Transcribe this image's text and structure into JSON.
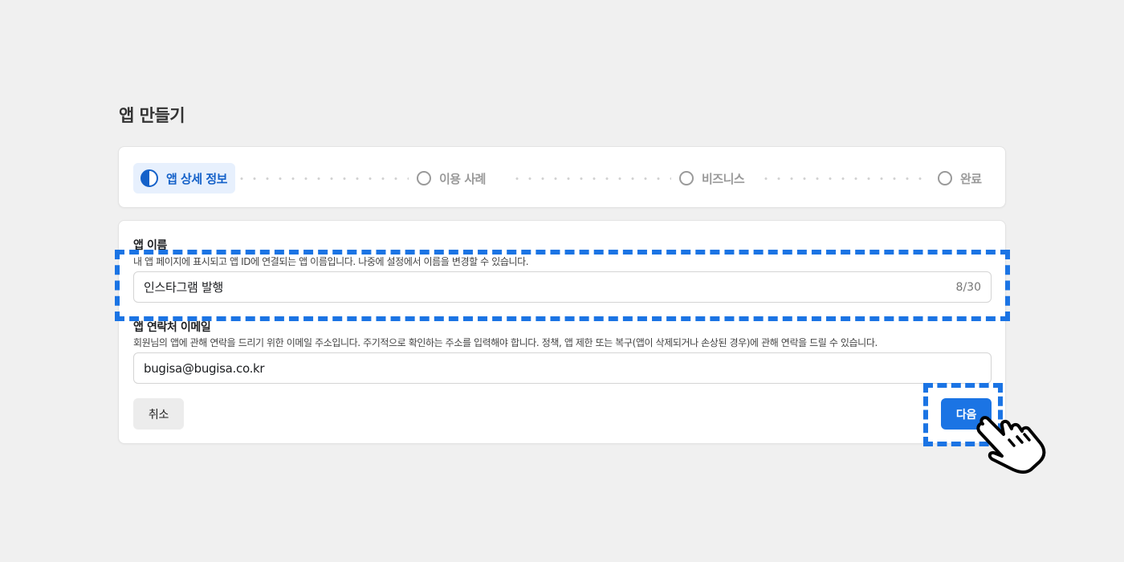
{
  "page": {
    "title": "앱 만들기"
  },
  "stepper": {
    "steps": [
      {
        "label": "앱 상세 정보",
        "state": "active"
      },
      {
        "label": "이용 사례",
        "state": "inactive"
      },
      {
        "label": "비즈니스",
        "state": "inactive"
      },
      {
        "label": "완료",
        "state": "inactive"
      }
    ]
  },
  "form": {
    "app_name": {
      "label": "앱 이름",
      "help": "내 앱 페이지에 표시되고 앱 ID에 연결되는 앱 이름입니다. 나중에 설정에서 이름을 변경할 수 있습니다.",
      "value": "인스타그램 발행",
      "counter": "8/30"
    },
    "contact_email": {
      "label": "앱 연락처 이메일",
      "help": "회원님의 앱에 관해 연락을 드리기 위한 이메일 주소입니다. 주기적으로 확인하는 주소를 입력해야 합니다. 정책, 앱 제한 또는 복구(앱이 삭제되거나 손상된 경우)에 관해 연락을 드릴 수 있습니다.",
      "value": "bugisa@bugisa.co.kr"
    }
  },
  "buttons": {
    "cancel": "취소",
    "next": "다음"
  },
  "colors": {
    "accent": "#1b74e4",
    "active_step": "#1461c9",
    "active_step_bg": "#e7f0fd",
    "highlight": "#1b74e4"
  },
  "icons": {
    "pointer": "hand-pointer-icon",
    "step_active": "half-filled-circle-icon",
    "step_inactive": "empty-circle-icon"
  }
}
